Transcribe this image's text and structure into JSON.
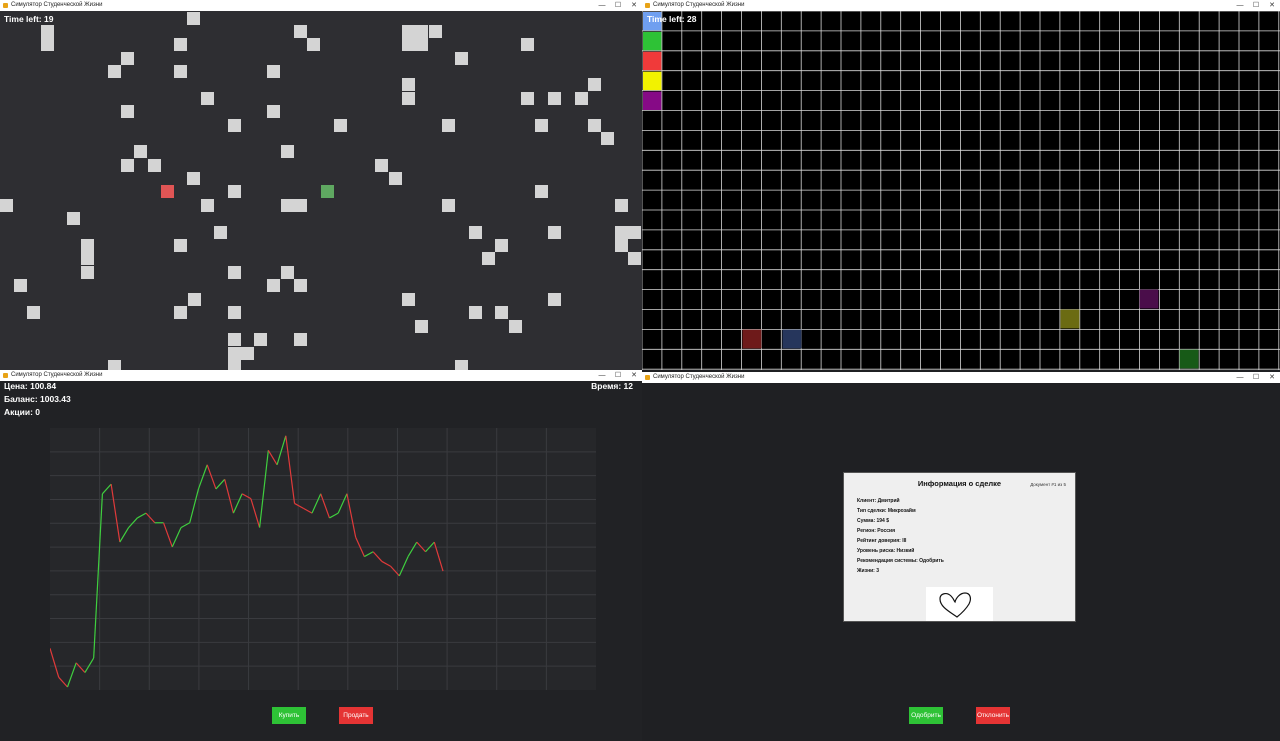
{
  "windows": {
    "top_left": {
      "title": "Симулятор Студенческой Жизни",
      "time_label": "Time left: 19"
    },
    "top_right": {
      "title": "Симулятор Студенческой Жизни",
      "time_label": "Time left: 28"
    },
    "bottom_left": {
      "title": "Симулятор Студенческой Жизни",
      "price": "Цена: 100.84",
      "balance": "Баланс: 1003.43",
      "shares": "Акции: 0",
      "time": "Время: 12",
      "buy_label": "Купить",
      "sell_label": "Продать"
    },
    "bottom_right": {
      "title": "Симулятор Студенческой Жизни",
      "card_title": "Информация о сделке",
      "doc_counter": "Документ #1 из 5",
      "fields": [
        "Клиент: Дмитрий",
        "Тип сделки: Микрозайм",
        "Сумма: 194 $",
        "Регион: Россия",
        "Рейтинг доверия: III",
        "Уровень риска: Низкий",
        "Рекомендация системы: Одобрить",
        "Жизни: 3"
      ],
      "approve_label": "Одобрить",
      "reject_label": "Отклонить"
    }
  },
  "window_controls": {
    "minimize": "—",
    "maximize": "☐",
    "close": "✕"
  },
  "colors": {
    "grid_bg": "#2e2e32",
    "grid_block": "#d4d4d4",
    "player_red": "#e05555",
    "target_green": "#5fa861",
    "chart_up": "#3fcf3f",
    "chart_down": "#e03a3a",
    "button_green": "#2ec236",
    "button_red": "#e53434",
    "palette": [
      "#6f9ff0",
      "#2ec236",
      "#f03a3a",
      "#f2f200",
      "#860a86"
    ]
  },
  "memory_game": {
    "palette_count": 5,
    "placed_colors": [
      "dark-red",
      "dark-blue",
      "dark-yellow",
      "dark-purple",
      "dark-green"
    ]
  },
  "chart_data": {
    "type": "line",
    "title": "",
    "xlabel": "",
    "ylabel": "",
    "x": [
      0,
      1,
      2,
      3,
      4,
      5,
      6,
      7,
      8,
      9,
      10,
      11,
      12,
      13,
      14,
      15,
      16,
      17,
      18,
      19,
      20,
      21,
      22,
      23,
      24,
      25,
      26,
      27,
      28,
      29,
      30,
      31,
      32,
      33,
      34,
      35,
      36,
      37,
      38,
      39,
      40,
      41,
      42,
      43,
      44,
      45,
      46,
      47,
      48,
      49
    ],
    "values": [
      98.8,
      98.2,
      98.0,
      98.5,
      98.3,
      98.6,
      102.0,
      102.2,
      101.0,
      101.3,
      101.5,
      101.6,
      101.4,
      101.4,
      100.9,
      101.3,
      101.4,
      102.1,
      102.6,
      102.1,
      102.3,
      101.6,
      102.0,
      101.9,
      101.3,
      102.9,
      102.6,
      103.2,
      101.8,
      101.7,
      101.6,
      102.0,
      101.5,
      101.6,
      102.0,
      101.1,
      100.7,
      100.8,
      100.6,
      100.5,
      100.3,
      100.7,
      101.0,
      100.8,
      101.0,
      100.4
    ],
    "colored_by_direction": true,
    "ylim": [
      98.0,
      103.3
    ],
    "grid": true
  }
}
